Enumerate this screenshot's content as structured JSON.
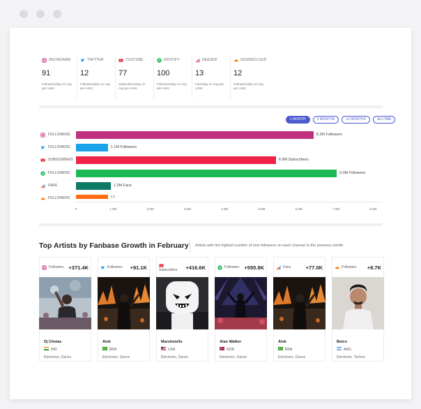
{
  "stats": [
    {
      "platform": "INSTAGRAM",
      "icon": "instagram-icon",
      "value": "91",
      "note": "Followers/day on Avg per Artist",
      "color": "#c13584"
    },
    {
      "platform": "TWITTER",
      "icon": "twitter-icon",
      "value": "12",
      "note": "Followers/day on Avg per Artist",
      "color": "#1da1f2"
    },
    {
      "platform": "YOUTUBE",
      "icon": "youtube-icon",
      "value": "77",
      "note": "Subscribers/day on Avg per Artist",
      "color": "#e62d3a"
    },
    {
      "platform": "SPOTIFY",
      "icon": "spotify-icon",
      "value": "100",
      "note": "Followers/day on Avg per Artist",
      "color": "#1db954"
    },
    {
      "platform": "DEEZER",
      "icon": "deezer-icon",
      "value": "13",
      "note": "Fans/day on Avg per Artist",
      "color": "#ff5a2c"
    },
    {
      "platform": "SOUNDCLOUD",
      "icon": "soundcloud-icon",
      "value": "12",
      "note": "Followers/day on Avg per Artist",
      "color": "#ff7700"
    }
  ],
  "ranges": [
    "1 MONTH",
    "3 MONTHS",
    "12 MONTHS",
    "ALLTIME"
  ],
  "active_range": "1 MONTH",
  "chart_data": {
    "type": "bar",
    "orientation": "horizontal",
    "categories": [
      "FOLLOWERS",
      "FOLLOWERS",
      "SUBSCRIBERS",
      "FOLLOWERS",
      "FANS",
      "FOLLOWERS"
    ],
    "platforms": [
      "instagram-icon",
      "twitter-icon",
      "youtube-icon",
      "spotify-icon",
      "deezer-icon",
      "soundcloud-icon"
    ],
    "values": [
      8.2,
      1.1,
      6.9,
      9.0,
      1.2,
      1.1
    ],
    "value_labels": [
      "8.2M Followers",
      "1.1M Followers",
      "6.9M Subscribers",
      "9.0M Followers",
      "1.2M Fans",
      "1.1"
    ],
    "colors": [
      "#c0327f",
      "#1aa3e8",
      "#f0234b",
      "#1db954",
      "#0d7a64",
      "#ff6a13"
    ],
    "xticks": [
      "0",
      "1.0M",
      "2.0M",
      "3.0M",
      "4.0M",
      "5.0M",
      "6.0M",
      "7.0M",
      "8.0M"
    ],
    "xlim": [
      0,
      9.0
    ],
    "unit": "M"
  },
  "section": {
    "title": "Top Artists by Fanbase Growth in February",
    "description": "Artists with the highest number of new followers on each channel in the previous month."
  },
  "artists": [
    {
      "source": "Followers",
      "icon": "instagram-icon",
      "growth": "+371.4K",
      "name": "Dj Chetas",
      "country": "IND",
      "genre": "Electronic, Dance",
      "photo": "dj-crowd"
    },
    {
      "source": "Followers",
      "icon": "twitter-icon",
      "growth": "+91.1K",
      "name": "Alok",
      "country": "BRA",
      "genre": "Electronic, Dance",
      "photo": "stage-fire"
    },
    {
      "source": "Subscribers",
      "icon": "youtube-icon",
      "growth": "+416.6K",
      "name": "Marshmello",
      "country": "USA",
      "genre": "Electronic, Dance",
      "photo": "helmet"
    },
    {
      "source": "Followers",
      "icon": "spotify-icon",
      "growth": "+555.8K",
      "name": "Alan Walker",
      "country": "NOR",
      "genre": "Electronic, Dance",
      "photo": "stage-blue"
    },
    {
      "source": "Fans",
      "icon": "deezer-icon",
      "growth": "+77.0K",
      "name": "Alok",
      "country": "BRA",
      "genre": "Electronic, Dance",
      "photo": "stage-fire"
    },
    {
      "source": "Followers",
      "icon": "soundcloud-icon",
      "growth": "+8.7K",
      "name": "Beico",
      "country": "ARG",
      "genre": "Electronic, Techno",
      "photo": "portrait"
    }
  ]
}
